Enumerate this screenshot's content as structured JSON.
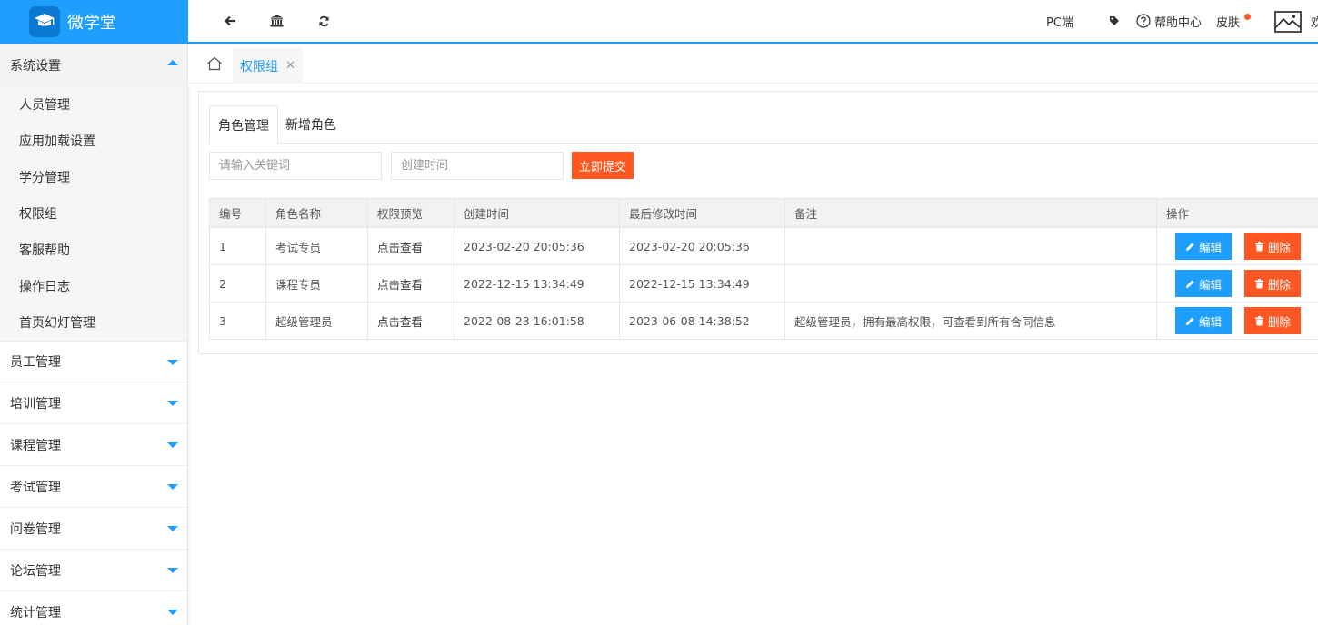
{
  "app": {
    "logo_text": "微学堂"
  },
  "header": {
    "pc_label": "PC端",
    "help_label": "帮助中心",
    "skin_label": "皮肤",
    "welcome_partial": "欢"
  },
  "sidebar": {
    "open_group": {
      "label": "系统设置",
      "items": [
        "人员管理",
        "应用加载设置",
        "学分管理",
        "权限组",
        "客服帮助",
        "操作日志",
        "首页幻灯管理"
      ]
    },
    "groups": [
      "员工管理",
      "培训管理",
      "课程管理",
      "考试管理",
      "问卷管理",
      "论坛管理",
      "统计管理"
    ]
  },
  "tabbar": {
    "active_tab": "权限组",
    "close": "✕"
  },
  "main": {
    "tabs": [
      "角色管理",
      "新增角色"
    ],
    "search": {
      "keyword_placeholder": "请输入关键词",
      "date_placeholder": "创建时间",
      "submit_label": "立即提交"
    },
    "table": {
      "headers": [
        "编号",
        "角色名称",
        "权限预览",
        "创建时间",
        "最后修改时间",
        "备注",
        "操作"
      ],
      "rows": [
        {
          "id": "1",
          "name": "考试专员",
          "preview": "点击查看",
          "created": "2023-02-20 20:05:36",
          "modified": "2023-02-20 20:05:36",
          "note": ""
        },
        {
          "id": "2",
          "name": "课程专员",
          "preview": "点击查看",
          "created": "2022-12-15 13:34:49",
          "modified": "2022-12-15 13:34:49",
          "note": ""
        },
        {
          "id": "3",
          "name": "超级管理员",
          "preview": "点击查看",
          "created": "2022-08-23 16:01:58",
          "modified": "2023-06-08 14:38:52",
          "note": "超级管理员，拥有最高权限，可查看到所有合同信息"
        }
      ],
      "edit_label": "编辑",
      "delete_label": "删除"
    }
  },
  "colors": {
    "primary": "#1E9FFF",
    "danger": "#FF5722"
  },
  "icons": [
    "graduation-cap-icon",
    "back-arrow-icon",
    "bank-icon",
    "refresh-icon",
    "tag-icon",
    "help-circle-icon",
    "avatar-image-icon",
    "home-icon",
    "pencil-icon",
    "trash-icon"
  ]
}
